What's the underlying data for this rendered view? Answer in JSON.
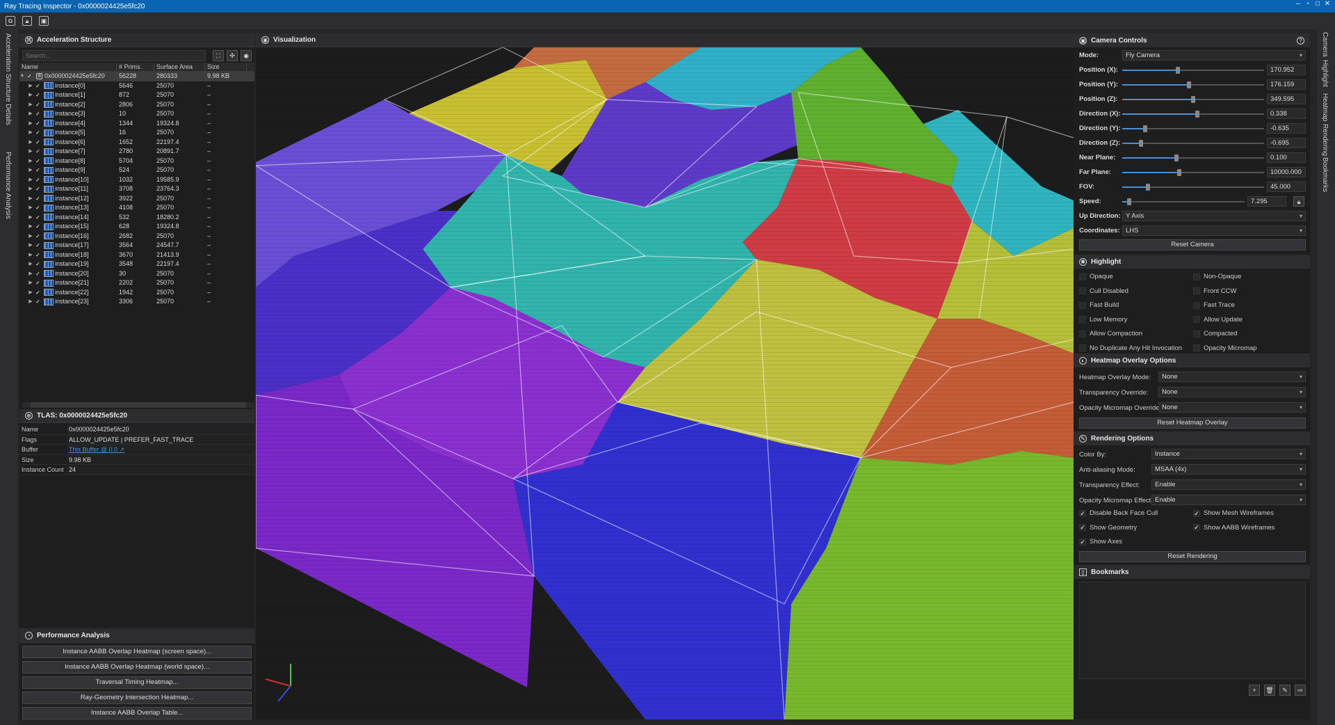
{
  "app": {
    "title": "Ray Tracing Inspector - 0x0000024425e5fc20"
  },
  "left_strip": {
    "tab1": "Acceleration Structure Details",
    "tab2": "Performance Analysis"
  },
  "right_strip": [
    "Camera",
    "Highlight",
    "Heatmap",
    "Rendering",
    "Bookmarks"
  ],
  "accel": {
    "title": "Acceleration Structure",
    "search_placeholder": "Search...",
    "columns": [
      "Name",
      "# Prims.",
      "Surface Area",
      "Size"
    ],
    "root": {
      "name": "0x0000024425e5fc20",
      "prims": "56228",
      "area": "280333",
      "size": "9.98 KB"
    },
    "instances": [
      {
        "name": "instance[0]",
        "prims": "5646",
        "area": "25070",
        "size": "–"
      },
      {
        "name": "instance[1]",
        "prims": "872",
        "area": "25070",
        "size": "–"
      },
      {
        "name": "instance[2]",
        "prims": "2806",
        "area": "25070",
        "size": "–"
      },
      {
        "name": "instance[3]",
        "prims": "10",
        "area": "25070",
        "size": "–"
      },
      {
        "name": "instance[4]",
        "prims": "1344",
        "area": "19324.8",
        "size": "–"
      },
      {
        "name": "instance[5]",
        "prims": "16",
        "area": "25070",
        "size": "–"
      },
      {
        "name": "instance[6]",
        "prims": "1652",
        "area": "22197.4",
        "size": "–"
      },
      {
        "name": "instance[7]",
        "prims": "2780",
        "area": "20891.7",
        "size": "–"
      },
      {
        "name": "instance[8]",
        "prims": "5704",
        "area": "25070",
        "size": "–"
      },
      {
        "name": "instance[9]",
        "prims": "524",
        "area": "25070",
        "size": "–"
      },
      {
        "name": "instance[10]",
        "prims": "1032",
        "area": "19585.9",
        "size": "–"
      },
      {
        "name": "instance[11]",
        "prims": "3708",
        "area": "23764.3",
        "size": "–"
      },
      {
        "name": "instance[12]",
        "prims": "3922",
        "area": "25070",
        "size": "–"
      },
      {
        "name": "instance[13]",
        "prims": "4108",
        "area": "25070",
        "size": "–"
      },
      {
        "name": "instance[14]",
        "prims": "532",
        "area": "18280.2",
        "size": "–"
      },
      {
        "name": "instance[15]",
        "prims": "628",
        "area": "19324.8",
        "size": "–"
      },
      {
        "name": "instance[16]",
        "prims": "2682",
        "area": "25070",
        "size": "–"
      },
      {
        "name": "instance[17]",
        "prims": "3564",
        "area": "24547.7",
        "size": "–"
      },
      {
        "name": "instance[18]",
        "prims": "3670",
        "area": "21413.9",
        "size": "–"
      },
      {
        "name": "instance[19]",
        "prims": "3548",
        "area": "22197.4",
        "size": "–"
      },
      {
        "name": "instance[20]",
        "prims": "30",
        "area": "25070",
        "size": "–"
      },
      {
        "name": "instance[21]",
        "prims": "2202",
        "area": "25070",
        "size": "–"
      },
      {
        "name": "instance[22]",
        "prims": "1942",
        "area": "25070",
        "size": "–"
      },
      {
        "name": "instance[23]",
        "prims": "3306",
        "area": "25070",
        "size": "–"
      }
    ]
  },
  "tlas": {
    "title": "TLAS: 0x0000024425e5fc20",
    "props": [
      {
        "k": "Name",
        "v": "0x0000024425e5fc20"
      },
      {
        "k": "Flags",
        "v": "ALLOW_UPDATE | PREFER_FAST_TRACE"
      },
      {
        "k": "Buffer",
        "v": "This Buffer @ 0.0 ↗"
      },
      {
        "k": "Size",
        "v": "9.98 KB"
      },
      {
        "k": "Instance Count",
        "v": "24"
      }
    ]
  },
  "perf": {
    "title": "Performance Analysis",
    "buttons": [
      "Instance AABB Overlap Heatmap (screen space)...",
      "Instance AABB Overlap Heatmap (world space)...",
      "Traversal Timing Heatmap...",
      "Ray-Geometry Intersection Heatmap...",
      "Instance AABB Overlap Table..."
    ]
  },
  "vis": {
    "title": "Visualization"
  },
  "camera": {
    "title": "Camera Controls",
    "mode_label": "Mode:",
    "mode": "Fly Camera",
    "sliders": [
      {
        "label": "Position (X):",
        "value": "170.952",
        "pos": 0.39
      },
      {
        "label": "Position (Y):",
        "value": "176.159",
        "pos": 0.47
      },
      {
        "label": "Position (Z):",
        "value": "349.595",
        "pos": 0.5
      },
      {
        "label": "Direction (X):",
        "value": "0.338",
        "pos": 0.53
      },
      {
        "label": "Direction (Y):",
        "value": "-0.635",
        "pos": 0.16
      },
      {
        "label": "Direction (Z):",
        "value": "-0.695",
        "pos": 0.13
      },
      {
        "label": "Near Plane:",
        "value": "0.100",
        "pos": 0.38
      },
      {
        "label": "Far Plane:",
        "value": "10000.000",
        "pos": 0.4
      },
      {
        "label": "FOV:",
        "value": "45.000",
        "pos": 0.18
      },
      {
        "label": "Speed:",
        "value": "7.295",
        "pos": 0.05
      }
    ],
    "up_label": "Up Direction:",
    "up": "Y Axis",
    "coord_label": "Coordinates:",
    "coord": "LHS",
    "reset": "Reset Camera"
  },
  "highlight": {
    "title": "Highlight",
    "left": [
      "Opaque",
      "Cull Disabled",
      "Fast Build",
      "Low Memory",
      "Allow Compaction",
      "No Duplicate Any Hit Invocation"
    ],
    "right": [
      "Non-Opaque",
      "Front CCW",
      "Fast Trace",
      "Allow Update",
      "Compacted",
      "Opacity Micromap"
    ]
  },
  "heatmap": {
    "title": "Heatmap Overlay Options",
    "rows": [
      {
        "label": "Heatmap Overlay Mode:",
        "value": "None"
      },
      {
        "label": "Transparency Override:",
        "value": "None"
      },
      {
        "label": "Opacity Micromap Override:",
        "value": "None"
      }
    ],
    "reset": "Reset Heatmap Overlay"
  },
  "rendering": {
    "title": "Rendering Options",
    "rows": [
      {
        "label": "Color By:",
        "value": "Instance"
      },
      {
        "label": "Anti-aliasing Mode:",
        "value": "MSAA (4x)"
      },
      {
        "label": "Transparency Effect:",
        "value": "Enable"
      },
      {
        "label": "Opacity Micromap Effect:",
        "value": "Enable"
      }
    ],
    "checks_left": [
      "Disable Back Face Cull",
      "Show Geometry",
      "Show Axes"
    ],
    "checks_right": [
      "Show Mesh Wireframes",
      "Show AABB Wireframes"
    ],
    "reset": "Reset Rendering"
  },
  "bookmarks": {
    "title": "Bookmarks"
  }
}
